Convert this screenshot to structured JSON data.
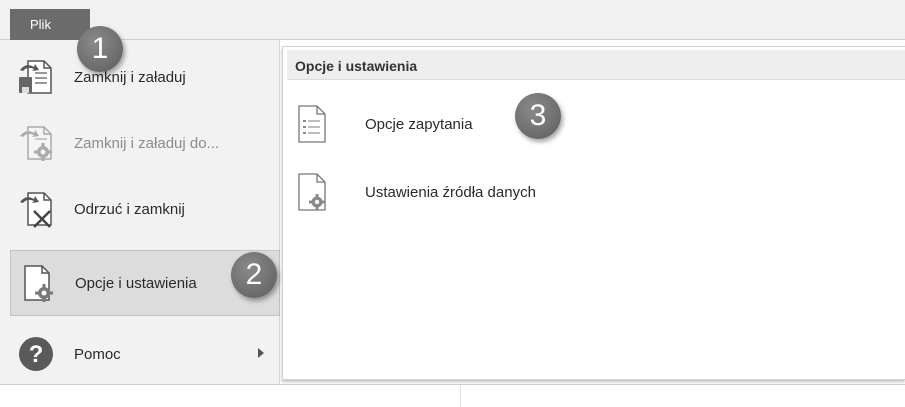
{
  "ribbon": {
    "file_tab_label": "Plik"
  },
  "menu": {
    "items": [
      {
        "label": "Zamknij i załaduj",
        "icon": "close-and-load-icon",
        "state": "enabled"
      },
      {
        "label": "Zamknij i załaduj do...",
        "icon": "close-and-load-to-icon",
        "state": "disabled"
      },
      {
        "label": "Odrzuć i zamknij",
        "icon": "discard-and-close-icon",
        "state": "enabled"
      },
      {
        "label": "Opcje i ustawienia",
        "icon": "options-settings-icon",
        "state": "selected"
      },
      {
        "label": "Pomoc",
        "icon": "help-icon",
        "state": "enabled",
        "has_submenu": true
      }
    ]
  },
  "panel": {
    "header": "Opcje i ustawienia",
    "options": [
      {
        "label": "Opcje zapytania",
        "icon": "query-options-icon"
      },
      {
        "label": "Ustawienia źródła danych",
        "icon": "data-source-settings-icon"
      }
    ]
  },
  "callouts": [
    "1",
    "2",
    "3"
  ],
  "colors": {
    "file_tab": "#6b6b6b",
    "callout": "#6a6a6a",
    "selected_bg": "#dcdcdc"
  }
}
